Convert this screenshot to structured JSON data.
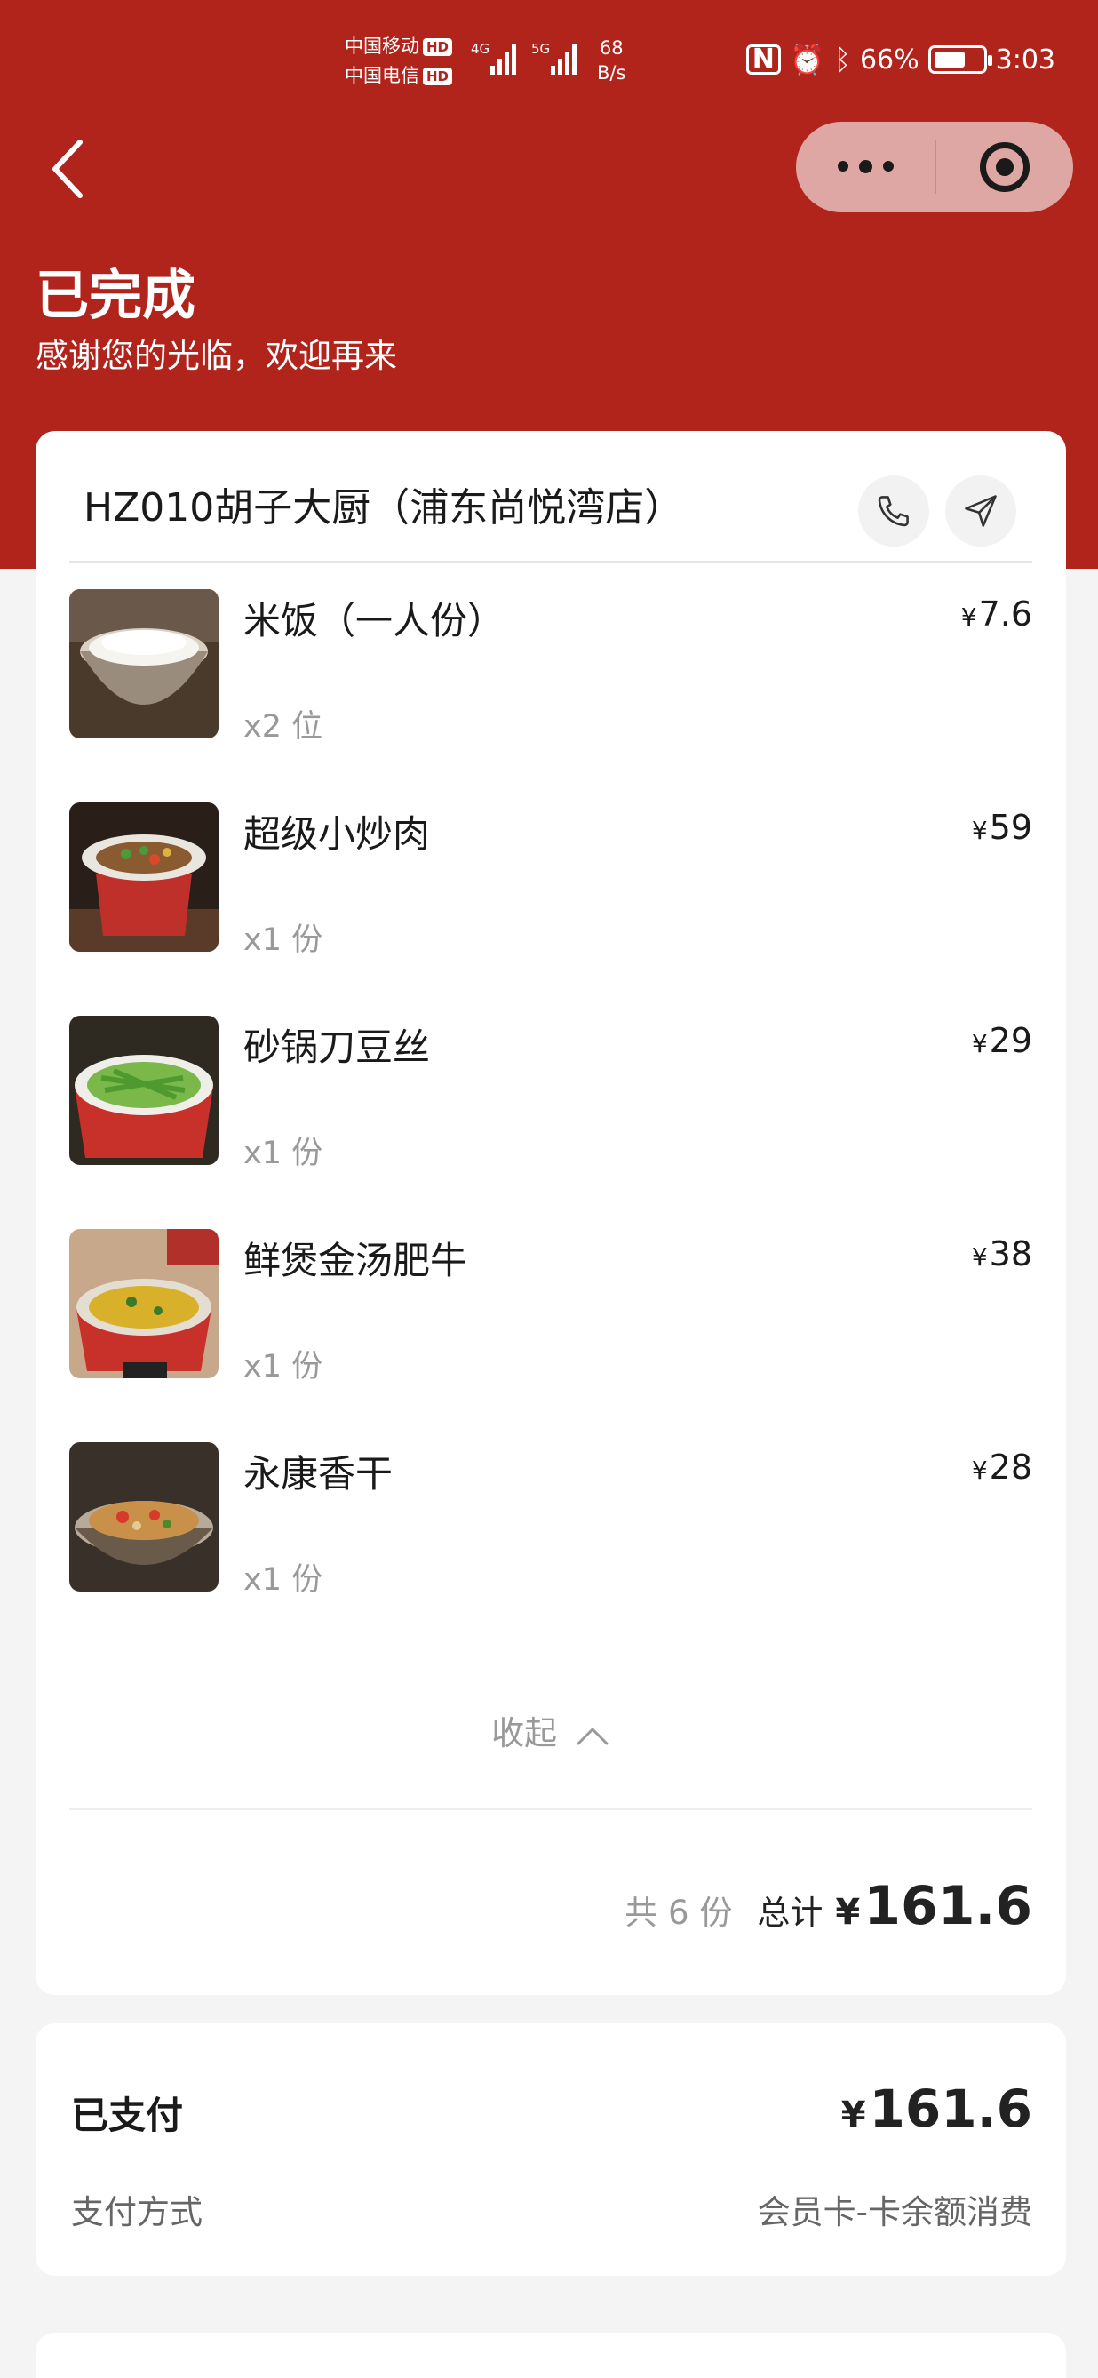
{
  "status_bar": {
    "carrier1": "中国移动",
    "carrier2": "中国电信",
    "hd": "HD",
    "net1": "4G",
    "net2": "5G",
    "speed_value": "68",
    "speed_unit": "B/s",
    "battery_percent": "66%",
    "battery_level": 0.66,
    "time": "3:03"
  },
  "nav": {
    "back_icon": "chevron-left-icon",
    "more_icon": "more-dots-icon",
    "close_icon": "target-icon"
  },
  "header": {
    "title": "已完成",
    "subtitle": "感谢您的光临，欢迎再来"
  },
  "store": {
    "name": "HZ010胡子大厨（浦东尚悦湾店）",
    "phone_icon": "phone-icon",
    "nav_icon": "navigation-arrow-icon"
  },
  "items": [
    {
      "name": "米饭（一人份）",
      "qty": "x2 位",
      "currency": "¥",
      "price": "7.6"
    },
    {
      "name": "超级小炒肉",
      "qty": "x1 份",
      "currency": "¥",
      "price": "59"
    },
    {
      "name": "砂锅刀豆丝",
      "qty": "x1 份",
      "currency": "¥",
      "price": "29"
    },
    {
      "name": "鲜煲金汤肥牛",
      "qty": "x1 份",
      "currency": "¥",
      "price": "38"
    },
    {
      "name": "永康香干",
      "qty": "x1 份",
      "currency": "¥",
      "price": "28"
    }
  ],
  "collapse_label": "收起",
  "summary": {
    "count": "共 6 份",
    "total_label": "总计",
    "currency": "¥",
    "total": "161.6"
  },
  "payment": {
    "status": "已支付",
    "currency": "¥",
    "amount": "161.6",
    "method_label": "支付方式",
    "method_value": "会员卡-卡余额消费"
  }
}
